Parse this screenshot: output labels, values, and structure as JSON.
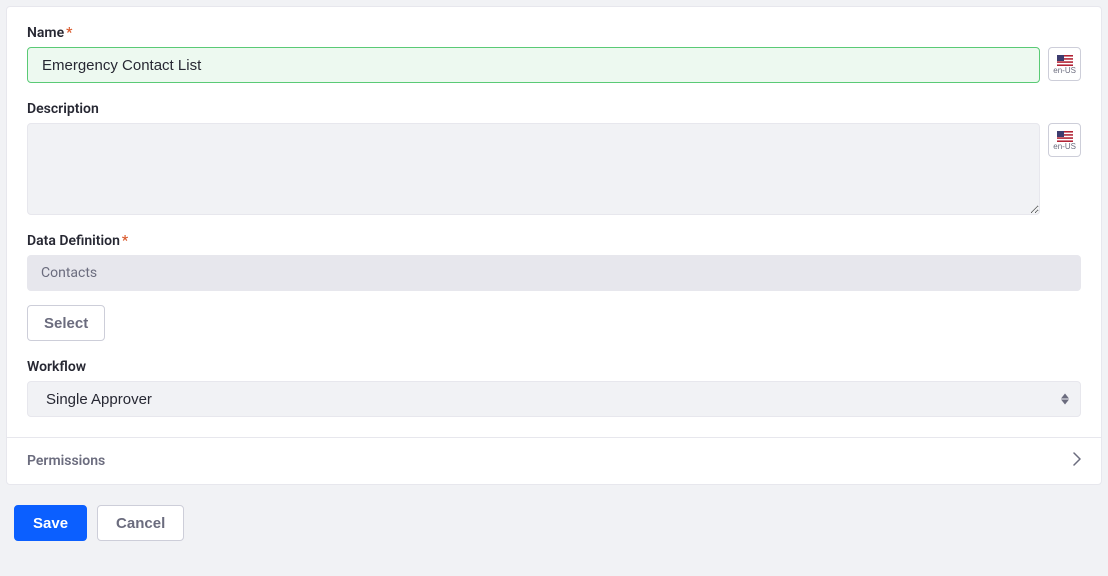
{
  "locale": {
    "code": "en-US"
  },
  "fields": {
    "name": {
      "label": "Name",
      "required": true,
      "value": "Emergency Contact List"
    },
    "description": {
      "label": "Description",
      "required": false,
      "value": ""
    },
    "dataDefinition": {
      "label": "Data Definition",
      "required": true,
      "value": "Contacts",
      "selectButton": "Select"
    },
    "workflow": {
      "label": "Workflow",
      "required": false,
      "value": "Single Approver",
      "options": [
        "Single Approver"
      ]
    }
  },
  "permissions": {
    "label": "Permissions"
  },
  "actions": {
    "save": "Save",
    "cancel": "Cancel"
  }
}
